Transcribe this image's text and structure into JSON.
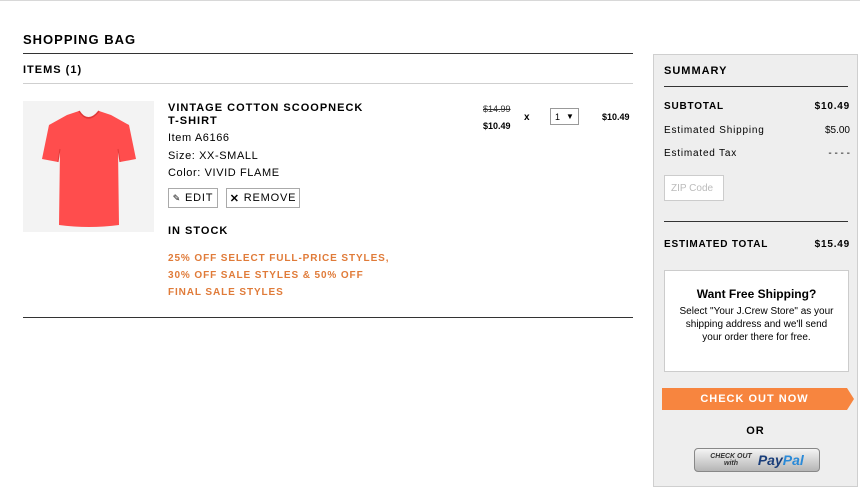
{
  "page": {
    "title": "SHOPPING BAG",
    "items_label": "ITEMS (1)"
  },
  "item": {
    "name": "VINTAGE COTTON SCOOPNECK T-SHIRT",
    "item_no": "Item A6166",
    "size": "Size: XX-SMALL",
    "color": "Color: VIVID FLAME",
    "product_color_hex": "#ff4d4d",
    "edit_label": "EDIT",
    "remove_label": "REMOVE",
    "stock": "IN STOCK",
    "promo": "25% OFF SELECT FULL-PRICE STYLES, 30% OFF SALE STYLES & 50% OFF FINAL SALE STYLES",
    "price_original": "$14.99",
    "price_sale": "$10.49",
    "times": "x",
    "quantity": "1",
    "line_total": "$10.49"
  },
  "summary": {
    "title": "SUMMARY",
    "subtotal_label": "SUBTOTAL",
    "subtotal_value": "$10.49",
    "shipping_label": "Estimated Shipping",
    "shipping_value": "$5.00",
    "tax_label": "Estimated Tax",
    "tax_value": "- - - -",
    "zip_placeholder": "ZIP Code",
    "total_label": "ESTIMATED TOTAL",
    "total_value": "$15.49",
    "free_title": "Want Free Shipping?",
    "free_text": "Select \"Your J.Crew Store\" as your shipping address and we'll send your order there for free.",
    "checkout_label": "CHECK OUT NOW",
    "or_label": "OR",
    "paypal_small_1": "CHECK OUT",
    "paypal_small_2": "with",
    "paypal_logo_1": "Pay",
    "paypal_logo_2": "Pal"
  },
  "colors": {
    "accent": "#f7853f",
    "promo": "#e07b39"
  }
}
